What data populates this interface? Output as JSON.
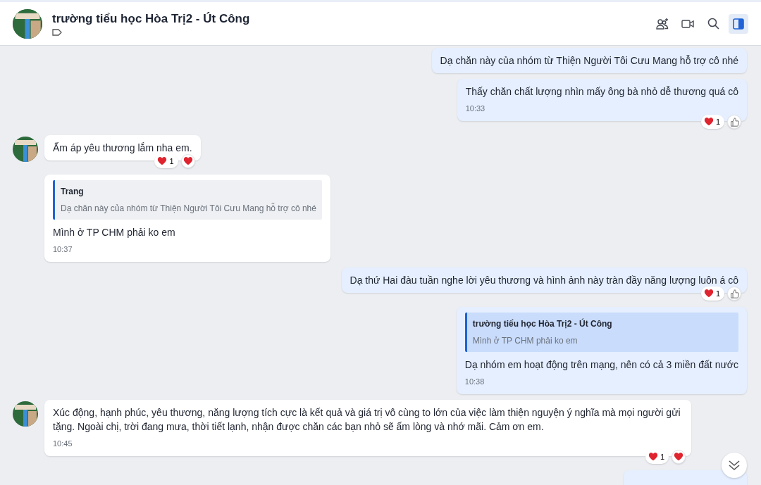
{
  "header": {
    "title": "trường tiểu học Hòa Trị2 - Út Công",
    "actions": [
      {
        "kind": "add-person",
        "selected": false
      },
      {
        "kind": "video",
        "selected": false
      },
      {
        "kind": "search",
        "selected": false
      },
      {
        "kind": "panel",
        "selected": true
      }
    ]
  },
  "messages": [
    {
      "kind": "out",
      "text": "Dạ  chăn này của nhóm từ Thiện Người Tôi Cưu Mang hỗ trợ cô nhé"
    },
    {
      "kind": "out",
      "text": "Thấy chăn chất lượng nhìn mấy ông bà nhỏ dễ thương quá cô",
      "time": "10:33",
      "reactions": [
        {
          "kind": "heart",
          "count": "1"
        },
        {
          "kind": "thumb"
        }
      ]
    },
    {
      "kind": "in",
      "avatar": true,
      "text": "Ấm áp yêu thương lắm nha em.",
      "reactions": [
        {
          "kind": "heart",
          "count": "1"
        },
        {
          "kind": "heart"
        }
      ]
    },
    {
      "kind": "in",
      "avatar": false,
      "quote": {
        "author": "Trang",
        "text": "Dạ chăn này của nhóm từ Thiện Người Tôi Cưu Mang hỗ trợ cô nhé"
      },
      "text": "Mình ở TP CHM phải ko em",
      "time": "10:37"
    },
    {
      "kind": "out",
      "text": "Dạ thứ Hai đàu tuần nghe lời yêu thương và hình ảnh này tràn đầy năng lượng luôn á cô",
      "reactions": [
        {
          "kind": "heart",
          "count": "1"
        },
        {
          "kind": "thumb"
        }
      ]
    },
    {
      "kind": "out",
      "quote": {
        "author": "trường tiểu học Hòa Trị2 - Út Công",
        "text": "Mình ở TP CHM phải ko em"
      },
      "text": "Dạ nhóm em hoạt động trên mạng, nên có cả 3 miền đất nước",
      "time": "10:38"
    },
    {
      "kind": "in",
      "avatar": true,
      "text": "Xúc động, hạnh phúc, yêu thương, năng lượng tích cực là kết quả và giá trị vô cùng to lớn của việc làm thiện nguyện ý nghĩa mà mọi người gửi tặng. Ngoài chị, trời đang mưa, thời tiết lạnh, nhận được chăn các bạn nhỏ sẽ ấm lòng và nhớ mãi.  Cảm ơn em.",
      "time": "10:45",
      "reactions": [
        {
          "kind": "heart",
          "count": "1"
        },
        {
          "kind": "heart"
        }
      ]
    },
    {
      "kind": "out"
    }
  ]
}
